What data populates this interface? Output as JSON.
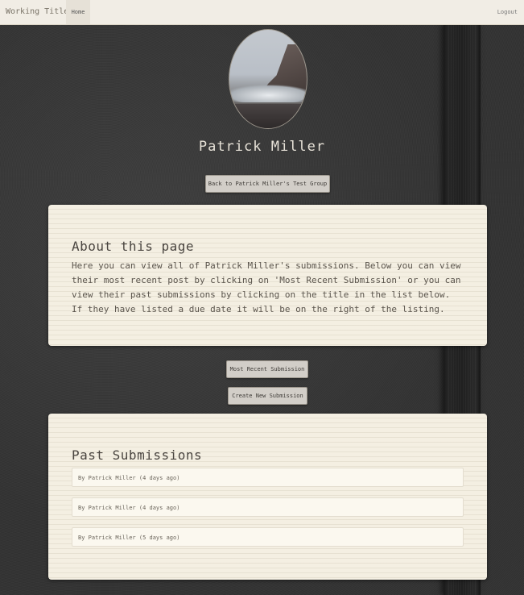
{
  "navbar": {
    "brand": "Working Title",
    "home": "Home",
    "logout": "Logout"
  },
  "profile": {
    "name": "Patrick Miller"
  },
  "buttons": {
    "back": "Back to Patrick Miller's Test Group",
    "most_recent": "Most Recent Submission",
    "create_new": "Create New Submission"
  },
  "about": {
    "title": "About this page",
    "text": "Here you can view all of Patrick Miller's submissions. Below you can view their most recent post by clicking on 'Most Recent Submission' or you can view their past submissions by clicking on the title in the list below. If they have listed a due date it will be on the right of the listing."
  },
  "past": {
    "title": "Past Submissions",
    "items": [
      {
        "label": "By Patrick Miller (4 days ago)"
      },
      {
        "label": "By Patrick Miller (4 days ago)"
      },
      {
        "label": "By Patrick Miller (5 days ago)"
      }
    ]
  }
}
